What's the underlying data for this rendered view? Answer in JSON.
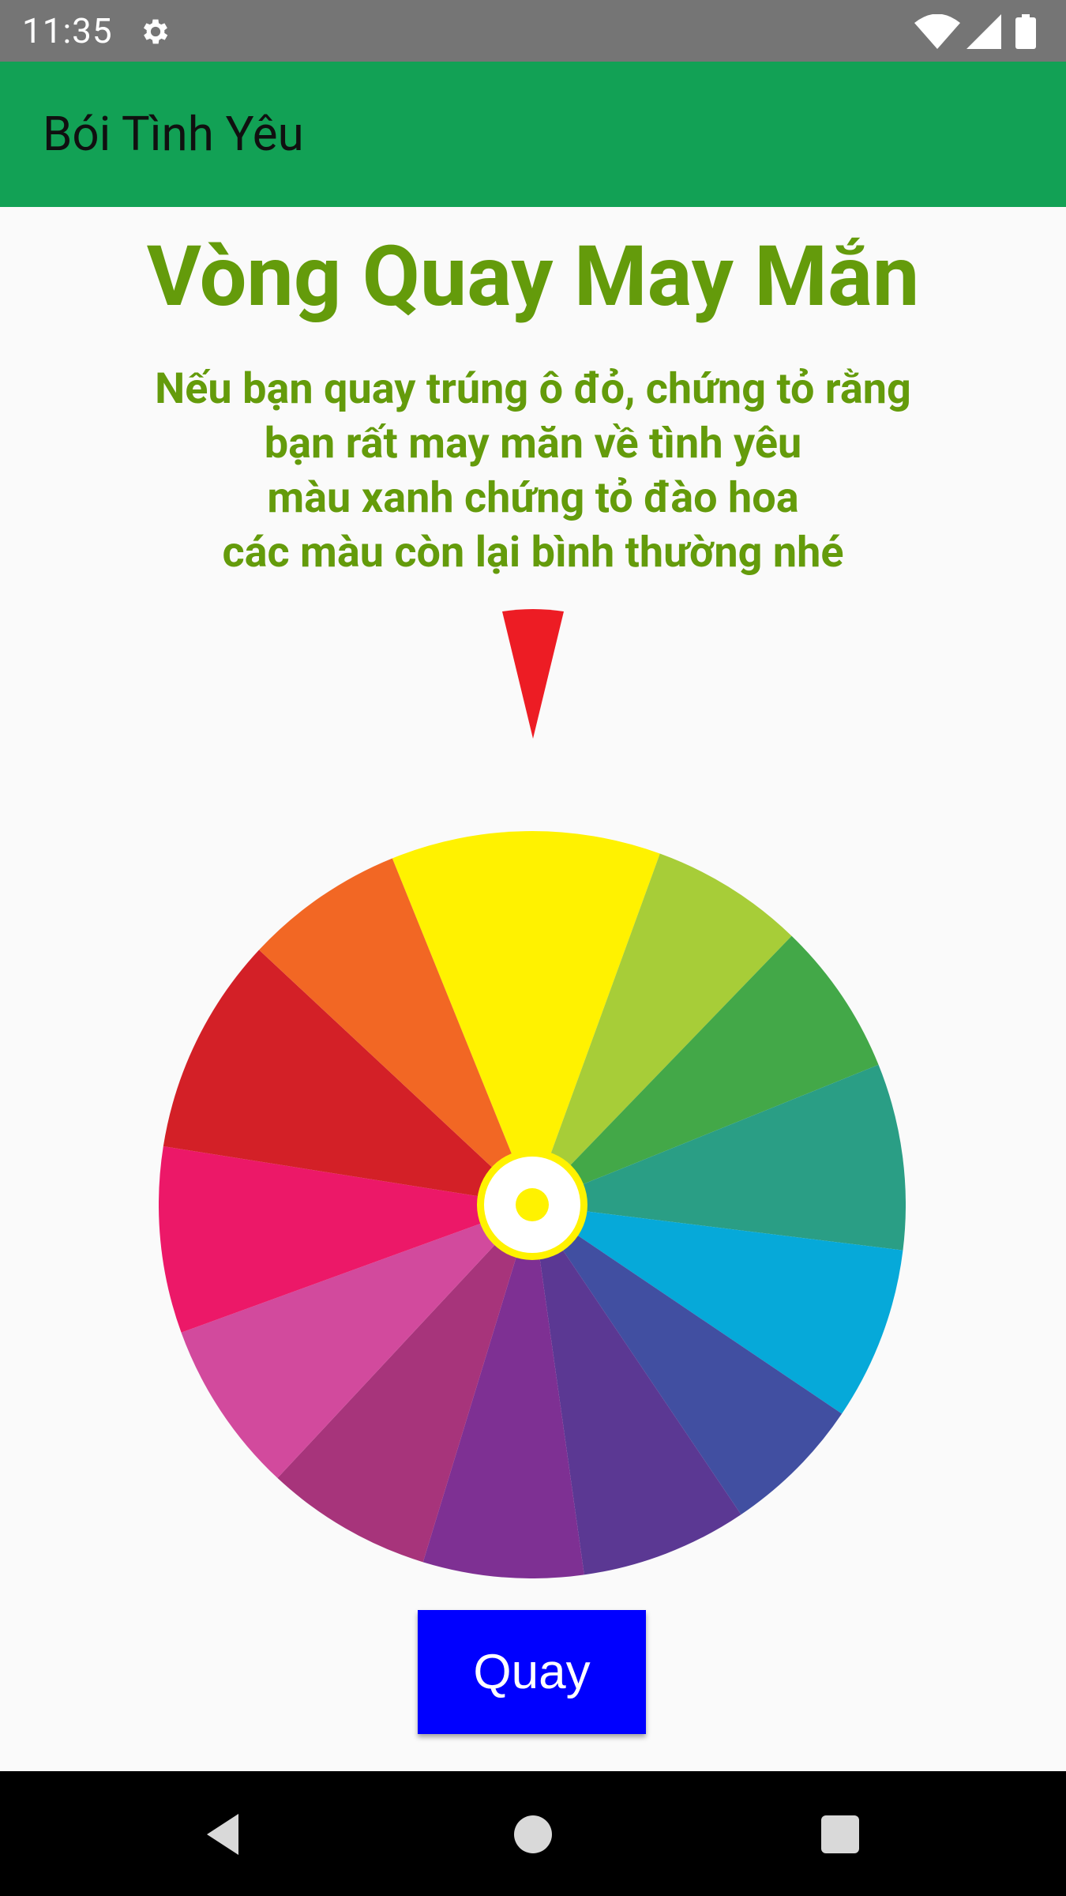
{
  "status_bar": {
    "time": "11:35",
    "icons": [
      "gear-icon",
      "wifi-icon",
      "cellular-icon",
      "battery-icon"
    ]
  },
  "app_bar": {
    "title": "Bói Tình Yêu"
  },
  "main": {
    "title": "Vòng Quay May Mắn",
    "instructions": [
      "Nếu bạn quay trúng ô đỏ, chứng tỏ rằng",
      "bạn rất may măn về tình yêu",
      "màu xanh chứng tỏ đào hoa",
      "các màu còn lại bình thường nhé"
    ],
    "spin_button_label": "Quay"
  },
  "pointer": {
    "color": "#ed1c24"
  },
  "wheel": {
    "segments": [
      {
        "color": "#fff200"
      },
      {
        "color": "#a7cd38"
      },
      {
        "color": "#43a848"
      },
      {
        "color": "#2a9e85"
      },
      {
        "color": "#06a9d9"
      },
      {
        "color": "#414fa1"
      },
      {
        "color": "#5b3893"
      },
      {
        "color": "#7e3093"
      },
      {
        "color": "#a7347b"
      },
      {
        "color": "#d24a9d"
      },
      {
        "color": "#ec1868"
      },
      {
        "color": "#d32027"
      },
      {
        "color": "#f26724"
      }
    ],
    "hub": {
      "ring_color": "#fff200",
      "fill_color": "#ffffff",
      "dot_color": "#fff200"
    }
  },
  "nav_bar": {
    "icons": [
      "back-icon",
      "home-icon",
      "recents-icon"
    ]
  },
  "colors": {
    "status_bar": "#757575",
    "app_bar": "#12a155",
    "title_text": "#649b0b",
    "button": "#0000ff",
    "background": "#fafafa"
  }
}
